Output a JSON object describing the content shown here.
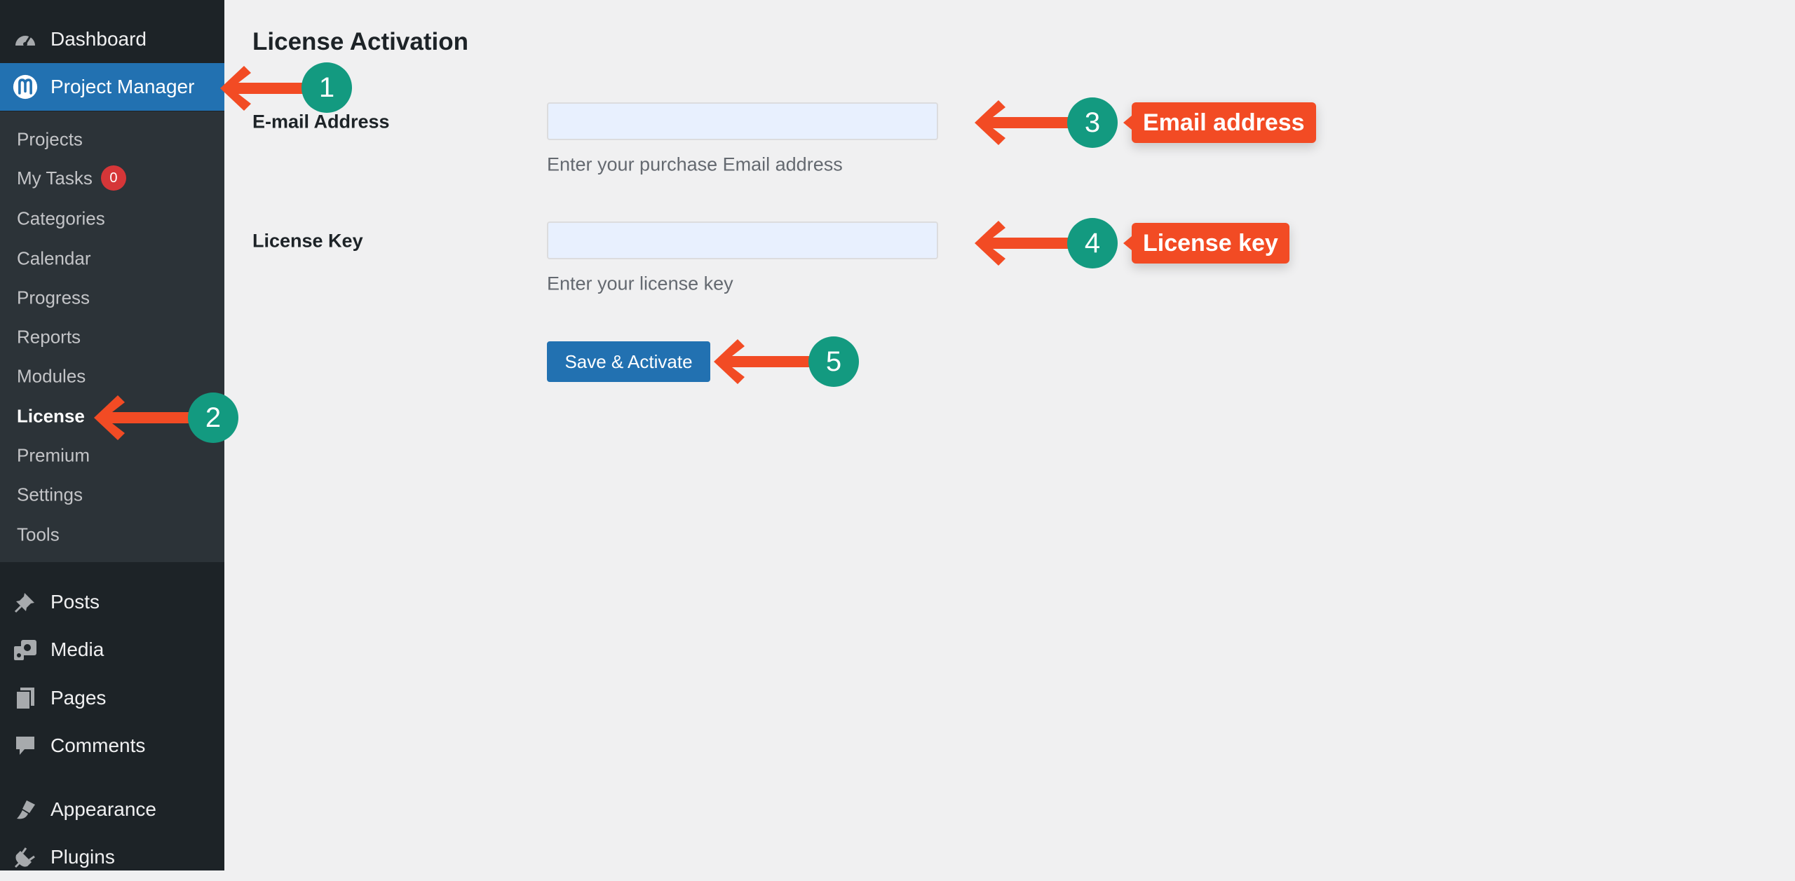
{
  "sidebar": {
    "dashboard": "Dashboard",
    "project_manager": "Project Manager",
    "submenu": [
      {
        "label": "Projects"
      },
      {
        "label": "My Tasks",
        "badge": "0"
      },
      {
        "label": "Categories"
      },
      {
        "label": "Calendar"
      },
      {
        "label": "Progress"
      },
      {
        "label": "Reports"
      },
      {
        "label": "Modules"
      },
      {
        "label": "License",
        "current": true
      },
      {
        "label": "Premium"
      },
      {
        "label": "Settings"
      },
      {
        "label": "Tools"
      }
    ],
    "bottom": [
      {
        "label": "Posts",
        "icon": "pin-icon"
      },
      {
        "label": "Media",
        "icon": "media-icon"
      },
      {
        "label": "Pages",
        "icon": "pages-icon"
      },
      {
        "label": "Comments",
        "icon": "comment-icon"
      },
      {
        "label": "Appearance",
        "icon": "paintbrush-icon"
      },
      {
        "label": "Plugins",
        "icon": "plugin-icon"
      }
    ]
  },
  "main": {
    "title": "License Activation",
    "email": {
      "label": "E-mail Address",
      "value": "",
      "placeholder": "",
      "description": "Enter your purchase Email address"
    },
    "license": {
      "label": "License Key",
      "value": "",
      "placeholder": "",
      "description": "Enter your license key"
    },
    "submit_label": "Save & Activate"
  },
  "annotations": {
    "step1": "1",
    "step2": "2",
    "step3": "3",
    "step4": "4",
    "step5": "5",
    "callout3": "Email address",
    "callout4": "License key"
  },
  "colors": {
    "sidebar_bg": "#1d2327",
    "submenu_bg": "#2c3338",
    "accent": "#2271b1",
    "badge": "#d63638",
    "arrow": "#f24b24",
    "step_circle": "#139a80"
  }
}
